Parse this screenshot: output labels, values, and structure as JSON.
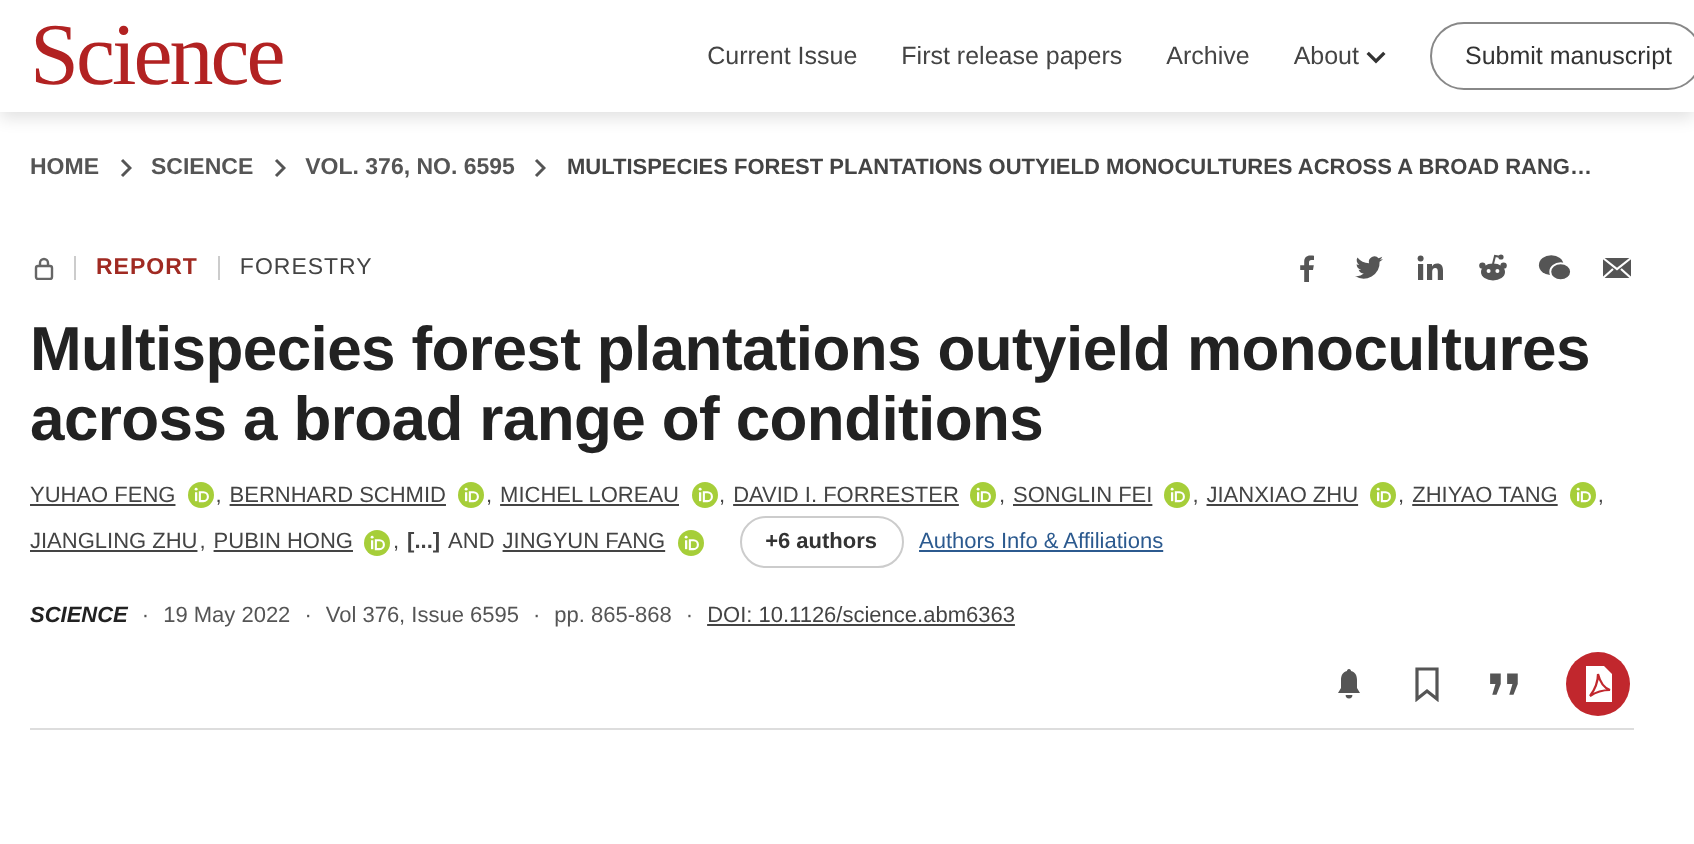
{
  "header": {
    "logo": "Science",
    "nav": [
      {
        "label": "Current Issue",
        "kind": "link"
      },
      {
        "label": "First release papers",
        "kind": "link"
      },
      {
        "label": "Archive",
        "kind": "link"
      },
      {
        "label": "About",
        "kind": "menu"
      }
    ],
    "submit": "Submit manuscript"
  },
  "breadcrumb": [
    "HOME",
    "SCIENCE",
    "VOL. 376, NO. 6595",
    "MULTISPECIES FOREST PLANTATIONS OUTYIELD MONOCULTURES ACROSS A BROAD RANG…"
  ],
  "article": {
    "type": "REPORT",
    "section": "FORESTRY",
    "title": "Multispecies forest plantations outyield monocultures across a broad range of conditions",
    "authors": [
      {
        "name": "YUHAO FENG",
        "orcid": true,
        "separator": ","
      },
      {
        "name": "BERNHARD SCHMID",
        "orcid": true,
        "separator": ","
      },
      {
        "name": "MICHEL LOREAU",
        "orcid": true,
        "separator": ","
      },
      {
        "name": "DAVID I. FORRESTER",
        "orcid": true,
        "separator": ","
      },
      {
        "name": "SONGLIN FEI",
        "orcid": true,
        "separator": ","
      },
      {
        "name": "JIANXIAO ZHU",
        "orcid": true,
        "separator": ","
      },
      {
        "name": "ZHIYAO TANG",
        "orcid": true,
        "separator": ","
      },
      {
        "name": "JIANGLING ZHU",
        "orcid": false,
        "separator": ","
      },
      {
        "name": "PUBIN HONG",
        "orcid": true,
        "separator": ","
      }
    ],
    "ellipsis": "[...]",
    "and": "AND",
    "last_author": {
      "name": "JINGYUN FANG",
      "orcid": true
    },
    "more_authors": "+6 authors",
    "affiliations": "Authors Info & Affiliations",
    "meta": [
      {
        "kind": "journal",
        "text": "SCIENCE"
      },
      {
        "kind": "separator",
        "text": "·"
      },
      {
        "kind": "date",
        "text": "19 May 2022"
      },
      {
        "kind": "separator",
        "text": "·"
      },
      {
        "kind": "volume",
        "text": "Vol 376, Issue 6595"
      },
      {
        "kind": "separator",
        "text": "·"
      },
      {
        "kind": "pages",
        "text": "pp. 865-868"
      },
      {
        "kind": "separator",
        "text": "·"
      },
      {
        "kind": "doi",
        "text": "DOI: 10.1126/science.abm6363"
      }
    ]
  }
}
